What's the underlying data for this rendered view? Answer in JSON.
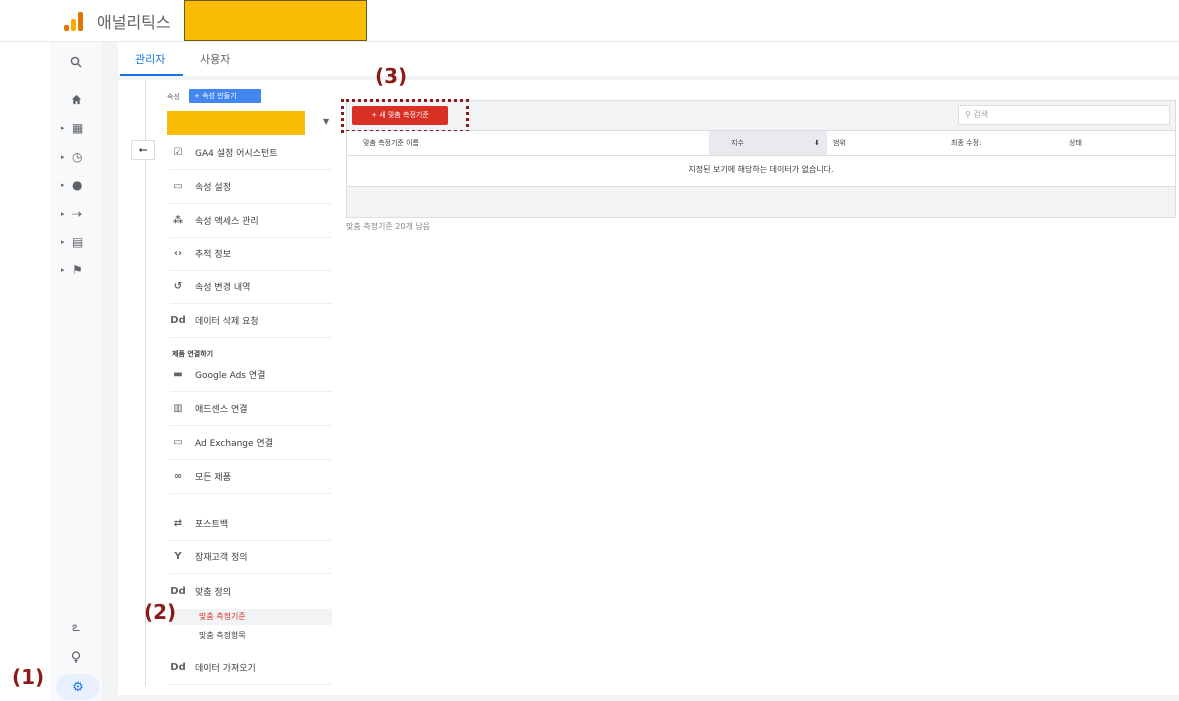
{
  "header": {
    "app_title": "애널리틱스"
  },
  "tabs": [
    {
      "label": "관리자"
    },
    {
      "label": "사용자"
    }
  ],
  "property": {
    "label": "속성",
    "create_button": "+ 속성 만들기"
  },
  "menu": [
    {
      "label": "GA4 설정 어시스턴트",
      "icon": "checkbox-icon"
    },
    {
      "label": "속성 설정",
      "icon": "window-icon"
    },
    {
      "label": "속성 액세스 관리",
      "icon": "people-icon"
    },
    {
      "label": "추적 정보",
      "icon": "code-icon"
    },
    {
      "label": "속성 변경 내역",
      "icon": "history-icon"
    },
    {
      "label": "데이터 삭제 요청",
      "icon": "dd-icon"
    }
  ],
  "product_links": {
    "title": "제품 연결하기",
    "items": [
      {
        "label": "Google Ads 연결",
        "icon": "ads-icon"
      },
      {
        "label": "애드센스 연결",
        "icon": "adsense-icon"
      },
      {
        "label": "Ad Exchange 연결",
        "icon": "window-icon"
      },
      {
        "label": "모든 제품",
        "icon": "link-icon"
      }
    ]
  },
  "more_menu": [
    {
      "label": "포스트백",
      "icon": "postback-icon"
    },
    {
      "label": "잠재고객 정의",
      "icon": "audience-icon"
    },
    {
      "label": "맞춤 정의",
      "icon": "dd-icon"
    }
  ],
  "custom_defs": [
    {
      "label": "맞춤 측정기준",
      "active": true
    },
    {
      "label": "맞춤 측정항목",
      "active": false
    }
  ],
  "data_import": {
    "label": "데이터 가져오기",
    "icon": "dd-icon"
  },
  "toolbar": {
    "new_button": "+ 새 맞춤 측정기준",
    "search_placeholder": "검색"
  },
  "table": {
    "columns": [
      "맞춤 측정기준 이름",
      "지수",
      "범위",
      "최종 수정:",
      "상태"
    ],
    "empty_message": "지정된 보기에 해당하는 데이터가 없습니다.",
    "remaining": "맞춤 측정기준 20개 남음"
  },
  "annotations": {
    "a1": "(1)",
    "a2": "(2)",
    "a3": "(3)"
  },
  "colors": {
    "accent": "#1a73e8",
    "primary_button": "#d93025",
    "highlight": "#fbbc04",
    "annotation": "#8b1a1a"
  }
}
